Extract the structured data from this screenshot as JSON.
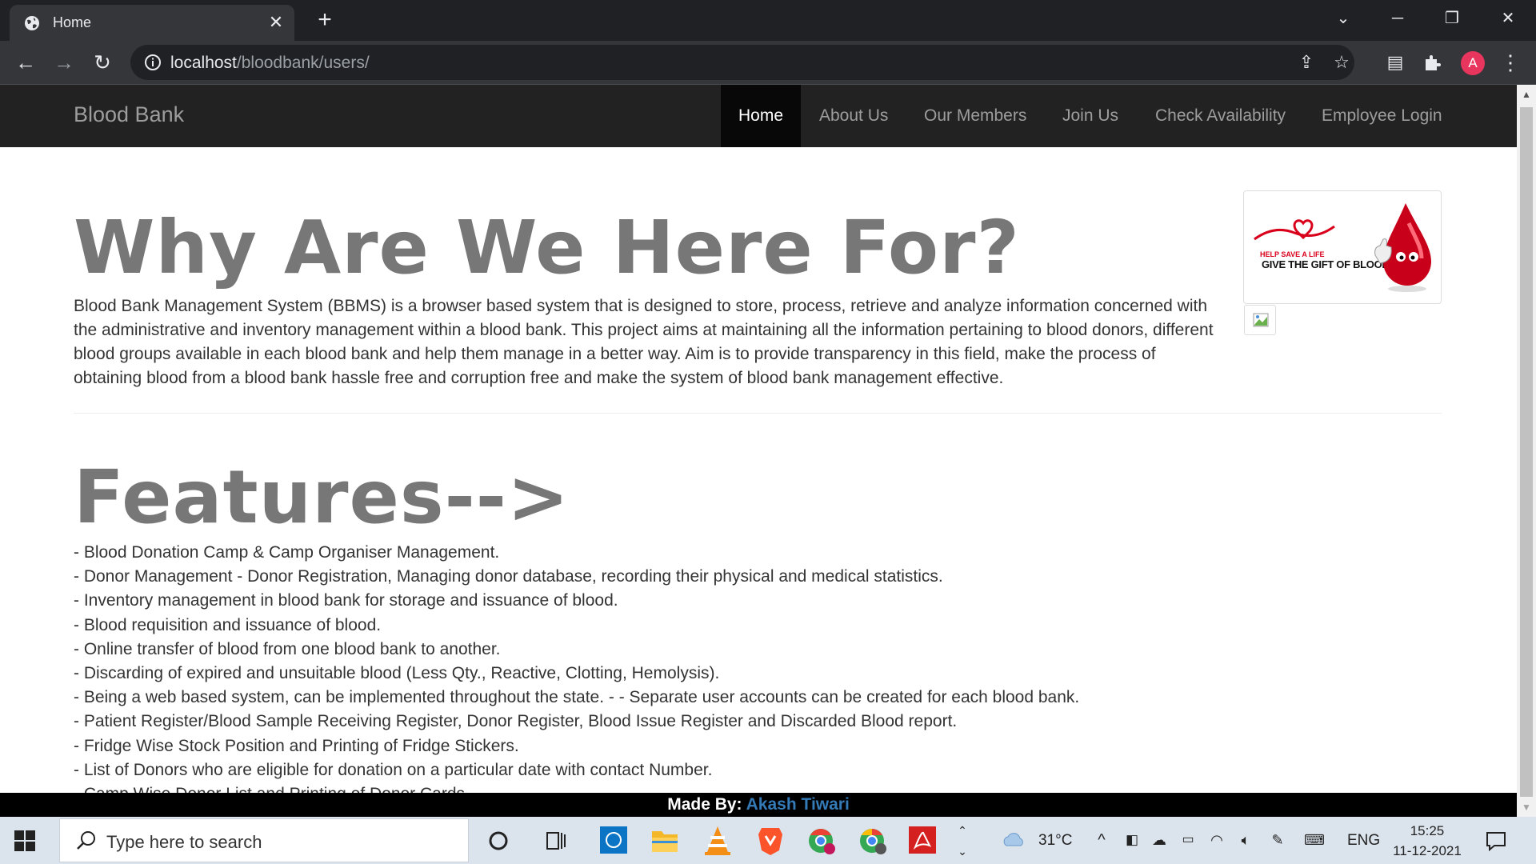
{
  "browser": {
    "tab_title": "Home",
    "url_host": "localhost",
    "url_path": "/bloodbank/users/",
    "profile_initial": "A"
  },
  "navbar": {
    "brand": "Blood Bank",
    "items": [
      {
        "label": "Home",
        "active": true
      },
      {
        "label": "About Us",
        "active": false
      },
      {
        "label": "Our Members",
        "active": false
      },
      {
        "label": "Join Us",
        "active": false
      },
      {
        "label": "Check Availability",
        "active": false
      },
      {
        "label": "Employee Login",
        "active": false
      }
    ]
  },
  "intro": {
    "title": "Why Are We Here For?",
    "body": "Blood Bank Management System (BBMS) is a browser based system that is designed to store, process, retrieve and analyze information concerned with the administrative and inventory management within a blood bank. This project aims at maintaining all the information pertaining to blood donors, different blood groups available in each blood bank and help them manage in a better way. Aim is to provide transparency in this field, make the process of obtaining blood from a blood bank hassle free and corruption free and make the system of blood bank management effective."
  },
  "ad": {
    "line1": "HELP SAVE A LIFE",
    "line2": "GIVE THE GIFT OF BLOOD"
  },
  "features": {
    "title": "Features-->",
    "items": [
      "- Blood Donation Camp & Camp Organiser Management.",
      "- Donor Management - Donor Registration, Managing donor database, recording their physical and medical statistics.",
      "- Inventory management in blood bank for storage and issuance of blood.",
      "- Blood requisition and issuance of blood.",
      "- Online transfer of blood from one blood bank to another.",
      "- Discarding of expired and unsuitable blood (Less Qty., Reactive, Clotting, Hemolysis).",
      "- Being a web based system, can be implemented throughout the state. - - Separate user accounts can be created for each blood bank.",
      "- Patient Register/Blood Sample Receiving Register, Donor Register, Blood Issue Register and Discarded Blood report.",
      "- Fridge Wise Stock Position and Printing of Fridge Stickers.",
      "- List of Donors who are eligible for donation on a particular date with contact Number.",
      "- Camp Wise Donor List and Printing of Donor Cards."
    ]
  },
  "footer": {
    "prefix": "Made By:",
    "author": "Akash Tiwari"
  },
  "taskbar": {
    "search_placeholder": "Type here to search",
    "weather": "31°C",
    "language": "ENG",
    "time": "15:25",
    "date": "11-12-2021"
  },
  "colors": {
    "navbar_bg": "#222222",
    "link_blue": "#337ab7",
    "heading_gray": "#777777"
  }
}
